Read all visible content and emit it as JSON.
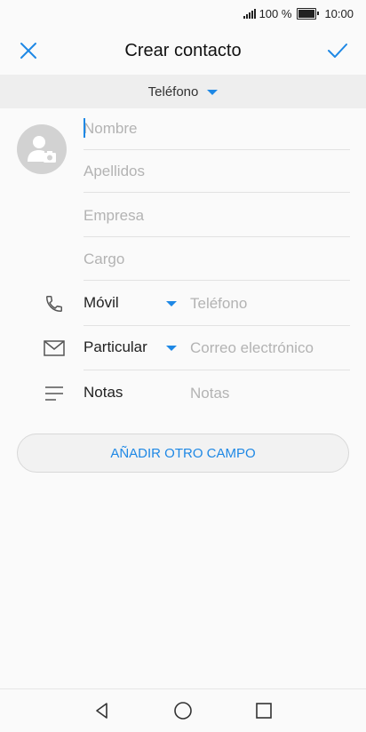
{
  "status": {
    "battery_percent": "100 %",
    "time": "10:00"
  },
  "header": {
    "title": "Crear contacto"
  },
  "account": {
    "label": "Teléfono"
  },
  "name_fields": {
    "first_name_placeholder": "Nombre",
    "last_name_placeholder": "Apellidos",
    "company_placeholder": "Empresa",
    "job_title_placeholder": "Cargo"
  },
  "phone_row": {
    "type_label": "Móvil",
    "placeholder": "Teléfono"
  },
  "email_row": {
    "type_label": "Particular",
    "placeholder": "Correo electrónico"
  },
  "notes_row": {
    "label": "Notas",
    "placeholder": "Notas"
  },
  "add_field_button": {
    "label": "AÑADIR OTRO CAMPO"
  },
  "colors": {
    "accent": "#1e88e5",
    "placeholder": "#b3b3b3",
    "divider": "#e2e2e2",
    "avatar_bg": "#d2d2d2"
  },
  "icons": {
    "close": "close-icon",
    "confirm": "check-icon",
    "dropdown": "caret-down-icon",
    "avatar": "contact-photo-icon",
    "phone": "phone-icon",
    "email": "mail-icon",
    "notes": "notes-icon",
    "nav_back": "back-triangle-icon",
    "nav_home": "home-circle-icon",
    "nav_recents": "recents-square-icon"
  }
}
